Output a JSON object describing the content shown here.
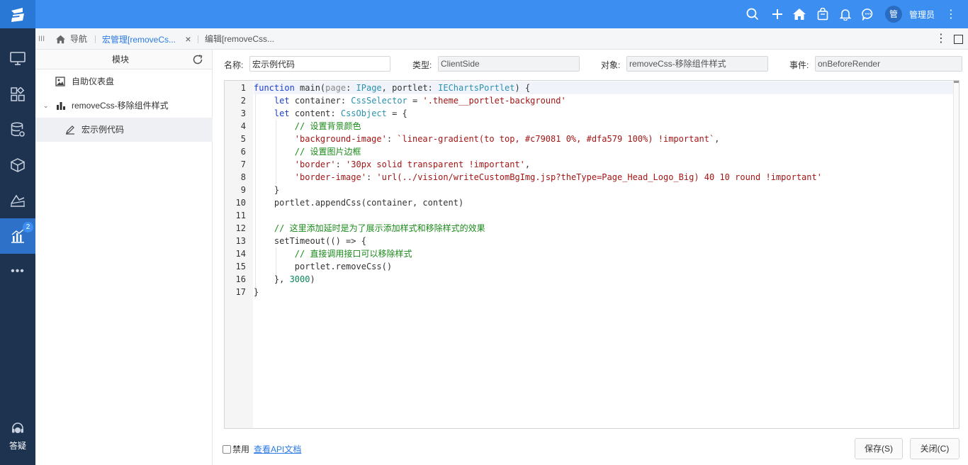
{
  "topbar": {
    "user_avatar": "管",
    "user_name": "管理员",
    "icons": [
      "search-icon",
      "plus-icon",
      "home-icon",
      "bag-icon",
      "bell-icon",
      "chat-icon",
      "more-vertical-icon"
    ]
  },
  "leftnav": {
    "items": [
      "monitor-icon",
      "dashboard-icon",
      "database-icon",
      "cube-icon",
      "analysis-icon",
      "chart-icon",
      "more-icon"
    ],
    "active_badge": "2",
    "help_label": "答疑"
  },
  "tabs": {
    "home_label": "导航",
    "active_tab_label": "宏管理[removeCs...",
    "edit_tab_label": "编辑[removeCss..."
  },
  "tree": {
    "header": "模块",
    "items": [
      {
        "label": "自助仪表盘",
        "icon": "dashboard-image-icon"
      },
      {
        "label": "removeCss-移除组件样式",
        "icon": "bar-chart-icon"
      },
      {
        "label": "宏示例代码",
        "icon": "edit-pen-icon"
      }
    ]
  },
  "form": {
    "name_label": "名称:",
    "name_value": "宏示例代码",
    "type_label": "类型:",
    "type_value": "ClientSide",
    "object_label": "对象:",
    "object_value": "removeCss-移除组件样式",
    "event_label": "事件:",
    "event_value": "onBeforeRender"
  },
  "code": {
    "line_numbers": [
      "1",
      "2",
      "3",
      "4",
      "5",
      "6",
      "7",
      "8",
      "9",
      "10",
      "11",
      "12",
      "13",
      "14",
      "15",
      "16",
      "17"
    ],
    "lines": [
      "function main(page: IPage, portlet: IEChartsPortlet) {",
      "    let container: CssSelector = '.theme__portlet-background'",
      "    let content: CssObject = {",
      "        // 设置背景颜色",
      "        'background-image': `linear-gradient(to top, #c79081 0%, #dfa579 100%) !important`,",
      "        // 设置图片边框",
      "        'border': '30px solid transparent !important',",
      "        'border-image': 'url(../vision/writeCustomBgImg.jsp?theType=Page_Head_Logo_Big) 40 10 round !important'",
      "    }",
      "    portlet.appendCss(container, content)",
      "",
      "    // 这里添加延时是为了展示添加样式和移除样式的效果",
      "    setTimeout(() => {",
      "        // 直接调用接口可以移除样式",
      "        portlet.removeCss()",
      "    }, 3000)",
      "}"
    ]
  },
  "footer": {
    "disable_label": "禁用",
    "api_link": "查看API文档",
    "save_button": "保存(S)",
    "close_button": "关闭(C)"
  },
  "colors": {
    "topbar": "#3c8ff0",
    "leftnav": "#1e3350",
    "accent": "#2d72c8"
  }
}
